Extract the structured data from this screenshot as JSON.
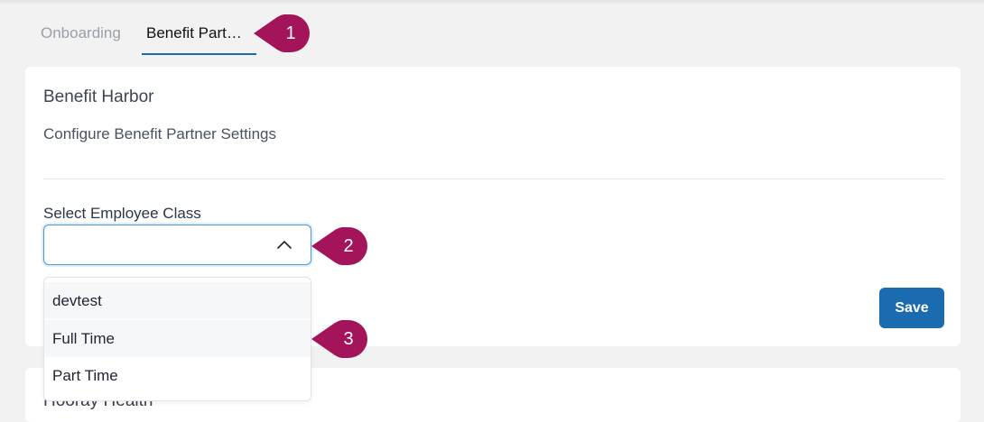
{
  "tabs": [
    {
      "label": "Onboarding"
    },
    {
      "label": "Benefit Partn…"
    }
  ],
  "card": {
    "title": "Benefit Harbor",
    "subtitle": "Configure Benefit Partner Settings",
    "field_label": "Select Employee Class",
    "select_value": "",
    "options": [
      {
        "label": "devtest"
      },
      {
        "label": "Full Time"
      },
      {
        "label": "Part Time"
      }
    ],
    "save_label": "Save"
  },
  "next_card": {
    "title": "Hooray Health"
  },
  "markers": [
    {
      "label": "1"
    },
    {
      "label": "2"
    },
    {
      "label": "3"
    }
  ],
  "colors": {
    "accent": "#1a6bb0",
    "marker": "#a3145a",
    "focus_border": "#4e9bd8"
  },
  "icons": {
    "select_toggle": "chevron-up-icon"
  }
}
